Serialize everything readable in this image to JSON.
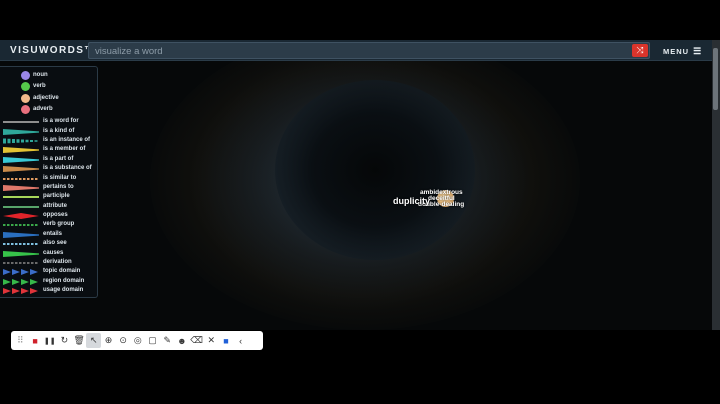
{
  "header": {
    "logo": "VISUWORDS™",
    "search_placeholder": "visualize a word",
    "shuffle_icon": "⤨",
    "menu_label": "MENU",
    "menu_icon": "☰"
  },
  "legend": {
    "parts_of_speech": [
      {
        "label": "noun",
        "color": "#9a86e6"
      },
      {
        "label": "verb",
        "color": "#55c94a"
      },
      {
        "label": "adjective",
        "color": "#f2b98a"
      },
      {
        "label": "adverb",
        "color": "#e9707e"
      }
    ],
    "relations": [
      {
        "label": "is a word for",
        "color": "#8e8e8e",
        "style": "solid"
      },
      {
        "label": "is a kind of",
        "color": "#2fa89a",
        "style": "taper"
      },
      {
        "label": "is an instance of",
        "color": "#2fa89a",
        "style": "dashed-taper"
      },
      {
        "label": "is a member of",
        "color": "#e3c334",
        "style": "taper"
      },
      {
        "label": "is a part of",
        "color": "#39c9d6",
        "style": "taper"
      },
      {
        "label": "is a substance of",
        "color": "#c98a4a",
        "style": "taper"
      },
      {
        "label": "is similar to",
        "color": "#e09a60",
        "style": "dashed"
      },
      {
        "label": "pertains to",
        "color": "#e0786a",
        "style": "taper"
      },
      {
        "label": "participle",
        "color": "#a6d65a",
        "style": "solid"
      },
      {
        "label": "attribute",
        "color": "#58a46a",
        "style": "solid"
      },
      {
        "label": "opposes",
        "color": "#e0242a",
        "style": "diamond"
      },
      {
        "label": "verb group",
        "color": "#3aa84a",
        "style": "dashed"
      },
      {
        "label": "entails",
        "color": "#2a6fbf",
        "style": "taper"
      },
      {
        "label": "also see",
        "color": "#7ec0e0",
        "style": "dashed"
      },
      {
        "label": "causes",
        "color": "#37c34a",
        "style": "taper"
      },
      {
        "label": "derivation",
        "color": "#6a6a6a",
        "style": "dashed"
      },
      {
        "label": "topic domain",
        "color": "#3b6dc9",
        "style": "arrows"
      },
      {
        "label": "region domain",
        "color": "#37b84a",
        "style": "arrows"
      },
      {
        "label": "usage domain",
        "color": "#e0343a",
        "style": "arrows"
      }
    ]
  },
  "graph": {
    "main_word": "duplicity",
    "related_words": [
      "ambidextrous",
      "deceitful",
      "double-dealing"
    ],
    "node_color": "#f0b874"
  },
  "toolbar": {
    "buttons": [
      {
        "name": "drag-handle-icon",
        "glyph": "⠿"
      },
      {
        "name": "record-stop-icon",
        "glyph": "■"
      },
      {
        "name": "pause-icon",
        "glyph": "❚❚"
      },
      {
        "name": "undo-icon",
        "glyph": "↻"
      },
      {
        "name": "trash-icon",
        "glyph": "🗑"
      },
      {
        "name": "pointer-icon",
        "glyph": "↖"
      },
      {
        "name": "zoom-cursor-icon",
        "glyph": "⊕"
      },
      {
        "name": "magnify-icon",
        "glyph": "⊙"
      },
      {
        "name": "spotlight-icon",
        "glyph": "◎"
      },
      {
        "name": "rectangle-icon",
        "glyph": "▢"
      },
      {
        "name": "pen-icon",
        "glyph": "✎"
      },
      {
        "name": "emoji-icon",
        "glyph": "☻"
      },
      {
        "name": "eraser-icon",
        "glyph": "⌫"
      },
      {
        "name": "mute-icon",
        "glyph": "✕"
      },
      {
        "name": "camera-icon",
        "glyph": "■"
      },
      {
        "name": "collapse-icon",
        "glyph": "‹"
      }
    ]
  }
}
